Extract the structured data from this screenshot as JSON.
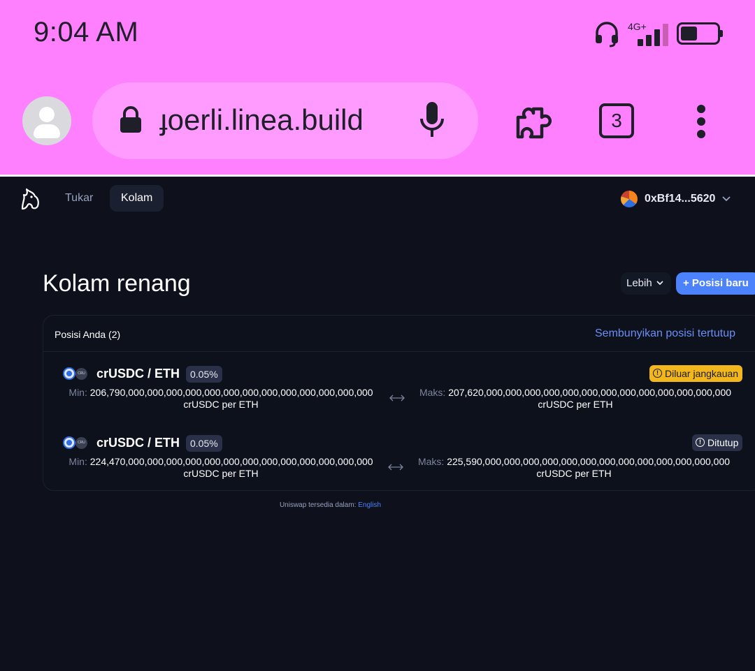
{
  "status_bar": {
    "time": "9:04 AM",
    "network": "4G+",
    "battery_level_pct": 45,
    "icons": [
      "headset-icon",
      "signal-icon",
      "battery-icon"
    ]
  },
  "browser": {
    "url": "ɟoerli.linea.build",
    "tab_count": "3",
    "icons": [
      "avatar-icon",
      "lock-icon",
      "mic-icon",
      "extensions-icon",
      "tabs-icon",
      "menu-icon"
    ],
    "accent": "#ff80ff"
  },
  "nav": {
    "tabs": [
      {
        "label": "Tukar",
        "active": false
      },
      {
        "label": "Kolam",
        "active": true
      }
    ],
    "wallet_address": "0xBf14...5620"
  },
  "header": {
    "title": "Kolam renang",
    "more_label": "Lebih",
    "new_position_label": "+ Posisi baru"
  },
  "positions_card": {
    "count_label": "Posisi Anda (2)",
    "hide_closed_label": "Sembunyikan posisi tertutup",
    "positions": [
      {
        "token_a_icon": "crusdc-icon",
        "token_b_label": "CRU",
        "pair": "crUSDC / ETH",
        "fee": "0.05%",
        "status": "Diluar jangkauan",
        "status_type": "warning",
        "min_label": "Min:",
        "min_value": "206,790,000,000,000,000,000,000,000,000,000,000,000,000,000",
        "min_unit": "crUSDC per ETH",
        "max_label": "Maks:",
        "max_value": "207,620,000,000,000,000,000,000,000,000,000,000,000,000,000",
        "max_unit": "crUSDC per ETH"
      },
      {
        "token_a_icon": "crusdc-icon",
        "token_b_label": "CRU",
        "pair": "crUSDC / ETH",
        "fee": "0.05%",
        "status": "Ditutup",
        "status_type": "closed",
        "min_label": "Min:",
        "min_value": "224,470,000,000,000,000,000,000,000,000,000,000,000,000,000",
        "min_unit": "crUSDC per ETH",
        "max_label": "Maks:",
        "max_value": "225,590,000,000,000,000,000,000,000,000,000,000,000,000,000",
        "max_unit": "crUSDC per ETH"
      }
    ]
  },
  "footer": {
    "available_in": "Uniswap tersedia dalam:",
    "language": "English"
  },
  "colors": {
    "background": "#0e111b",
    "accent_blue": "#4c82fb",
    "warning": "#f3b71e"
  }
}
